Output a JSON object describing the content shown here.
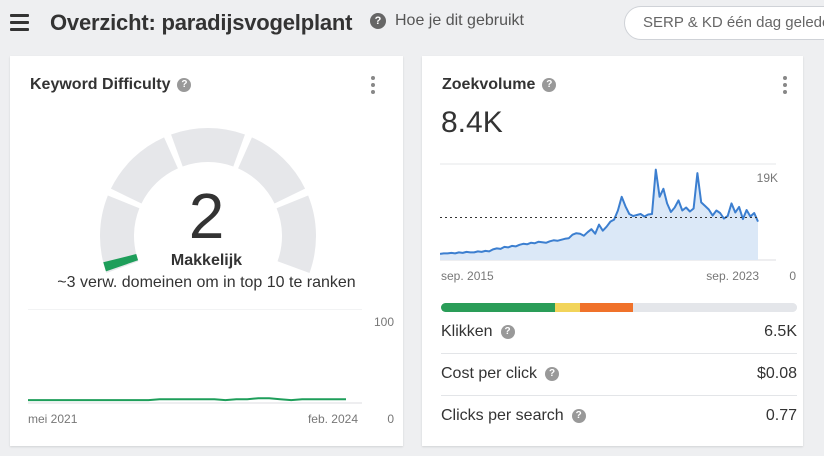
{
  "header": {
    "title": "Overzicht: paradijsvogelplant",
    "help_label": "Hoe je dit gebruikt",
    "serp_button": "SERP & KD één dag geleden bijgewerkt"
  },
  "keyword_difficulty": {
    "title": "Keyword Difficulty",
    "value": "2",
    "label": "Makkelijk",
    "description": "~3 verw. domeinen om in top 10 te ranken",
    "scale_max": 100,
    "gauge_colors": [
      "#1e9e5a",
      "#e6e7ea"
    ],
    "chart": {
      "x_start": "mei 2021",
      "x_end": "feb. 2024",
      "y_max_label": "100",
      "y_min_label": "0",
      "line_color": "#1e9e5a"
    }
  },
  "search_volume": {
    "title": "Zoekvolume",
    "value": "8.4K",
    "chart": {
      "x_start": "sep. 2015",
      "x_end": "sep. 2023",
      "y_max_label": "19K",
      "y_min_label": "0",
      "line_color": "#3c7fd0",
      "fill_color": "#dbe8f7"
    },
    "intent_bar": [
      {
        "fraction": 0.32,
        "color": "#2a9d58"
      },
      {
        "fraction": 0.07,
        "color": "#f2d45a"
      },
      {
        "fraction": 0.15,
        "color": "#f0722a"
      },
      {
        "fraction": 0.46,
        "color": "#e4e6ea"
      }
    ],
    "metrics": [
      {
        "label": "Klikken",
        "value": "6.5K"
      },
      {
        "label": "Cost per click",
        "value": "$0.08"
      },
      {
        "label": "Clicks per search",
        "value": "0.77"
      }
    ]
  },
  "chart_data": [
    {
      "type": "line",
      "title": "",
      "x_labels": [
        "mei 2021",
        "feb. 2024"
      ],
      "ylim": [
        0,
        100
      ],
      "series": [
        {
          "values": [
            2,
            2,
            2,
            2,
            2,
            2,
            2,
            2,
            2,
            2,
            2,
            2,
            3,
            3,
            3,
            3,
            3,
            3,
            2,
            3,
            3,
            4,
            4,
            3,
            2,
            3,
            3,
            3,
            3,
            3
          ]
        }
      ]
    },
    {
      "type": "area",
      "title": "",
      "x_labels": [
        "sep. 2015",
        "sep. 2023"
      ],
      "ylim": [
        0,
        19000
      ],
      "reference_value": 8400,
      "series": [
        {
          "values": [
            1200,
            1300,
            1300,
            1400,
            1300,
            1500,
            1400,
            1600,
            1500,
            1500,
            1700,
            1600,
            1800,
            1700,
            2100,
            2300,
            2200,
            2600,
            2500,
            2800,
            2700,
            3000,
            3200,
            3100,
            3400,
            3300,
            3600,
            3500,
            3400,
            3700,
            3900,
            3800,
            4000,
            4200,
            4300,
            5000,
            5300,
            5200,
            4800,
            5500,
            6100,
            5200,
            7000,
            5800,
            6600,
            7600,
            8000,
            9800,
            12500,
            10600,
            9100,
            8700,
            8900,
            9100,
            8600,
            9000,
            9100,
            17900,
            12500,
            14100,
            11200,
            9500,
            10400,
            11800,
            9800,
            10400,
            9600,
            10200,
            17200,
            11400,
            10700,
            10000,
            8800,
            9800,
            9300,
            8200,
            8700,
            11200,
            9400,
            10500,
            8100,
            9900,
            8600,
            9300,
            7600
          ]
        }
      ]
    }
  ]
}
